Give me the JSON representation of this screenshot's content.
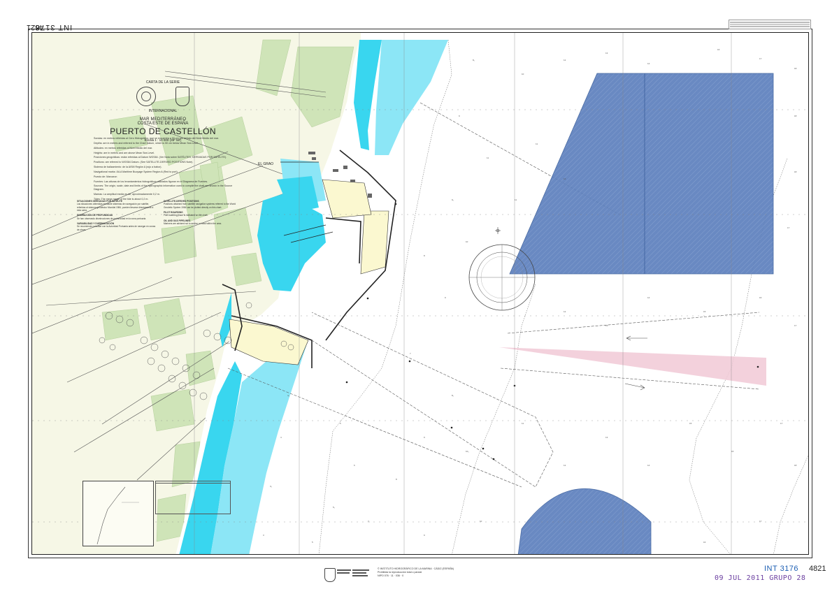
{
  "chart": {
    "int_number": "INT 3176",
    "chart_number": "4821",
    "series": "CARTA DE LA SERIE",
    "international": "INTERNACIONAL",
    "sea": "MAR MEDITERRÁNEO",
    "coast": "COSTA ESTE DE ESPAÑA",
    "port": "PUERTO DE CASTELLÓN",
    "scale": "Escala 1 : 10 000 (39º 58')",
    "place_el_grao": "EL GRAO",
    "stamp": "09 JUL 2011 GRUPO 28"
  },
  "notes": {
    "sondas": "Sondas: en metros referidas al Cero Hidrográfico, que se encuentra a 50 cm por debajo del Nivel Medio del mar.",
    "depths": "Depths: are in metres and referred to the Chart Datum, which is 50 cm below Mean Sea Level.",
    "altitudes": "Altitudes: en metros referidas al Nivel Medio del mar.",
    "heights": "Heights: are in metres and are above Mean Sea Level.",
    "posiciones": "Posiciones geográficas: están referidas al Datum WGS84. (Ver Nota sobre SATÉLITES, DERIVADAS POR SATÉLITE).",
    "positions": "Positions: are referred to WGS84 Datum. (See SATELLITE-DERIVED POSITIONS Note).",
    "balizamiento": "Sistema de balizamiento: de la AISM Región A (rojo a babor).",
    "buoyage": "Navigational marks: IALA Maritime Buoyage System Region A (Red to port).",
    "puesto": "Puesto de: Marcaron",
    "fuentes": "Fuentes: Las alturas de los levantamientos hidrográficos utilizados figuran en el Diagrama de Fuentes.",
    "sources": "Sources: The origin, scale, date and limits of the hydrographic information used to compile the chart are shown in the Source Diagram.",
    "mareas": "Mareas: La amplitud media es de, aproximadamente 0,2 m.",
    "tides": "Tides: The mean range of the tide is about 0,2 m."
  },
  "notes_cols": {
    "left_title": "SITUACIONES DERIVADAS POR SATÉLITE",
    "left_text": "Las situaciones obtenidas mediante sistemas de navegación por satélite, referidas al sistema geodésico Mundial 1984, pueden llevarse directamente a esta carta.",
    "left_title2": "DISMINUCIÓN DE PROFUNDIDAD",
    "left_text2": "Se han observado disminuciones de profundidad en la zona portuaria.",
    "left_title3": "VARIABILIDAD Y DUERMAGACIÓN",
    "left_text3": "Se recomienda consultar con la Autoridad Portuaria antes de navegar en zonas de obras.",
    "right_title": "SATELLITE-DERIVED POSITIONS",
    "right_text": "Positions obtained from satellite navigation systems referred to the World Geodetic System 1984 can be plotted directly on this chart.",
    "right_title2": "PILOT BOARDING",
    "right_text2": "Pilot boarding place is indicated on the chart.",
    "right_title3": "OIL AND GAS PIPELINES",
    "right_text3": "Mariners are advised not to anchor or trawl within the area."
  },
  "imprint": {
    "line1": "© INSTITUTO HIDROGRÁFICO DE LA MARINA · CÁDIZ (ESPAÑA)",
    "line2": "Prohibida la reproducción total o parcial",
    "line3": "NIPO 076 · 11 · 036 · 0"
  },
  "colors": {
    "land": "#f6f7e6",
    "green": "#cfe4b8",
    "cyan": "#39d6ef",
    "blue_zone": "#5579b8",
    "pink_zone": "#f1c9d6",
    "harbor": "#fbf8d0",
    "line": "#2a2a2a"
  },
  "icons": {
    "compass": "compass-rose-icon",
    "buoy": "buoy-icon",
    "anchor": "anchor-icon",
    "arrow": "current-arrow-icon"
  }
}
